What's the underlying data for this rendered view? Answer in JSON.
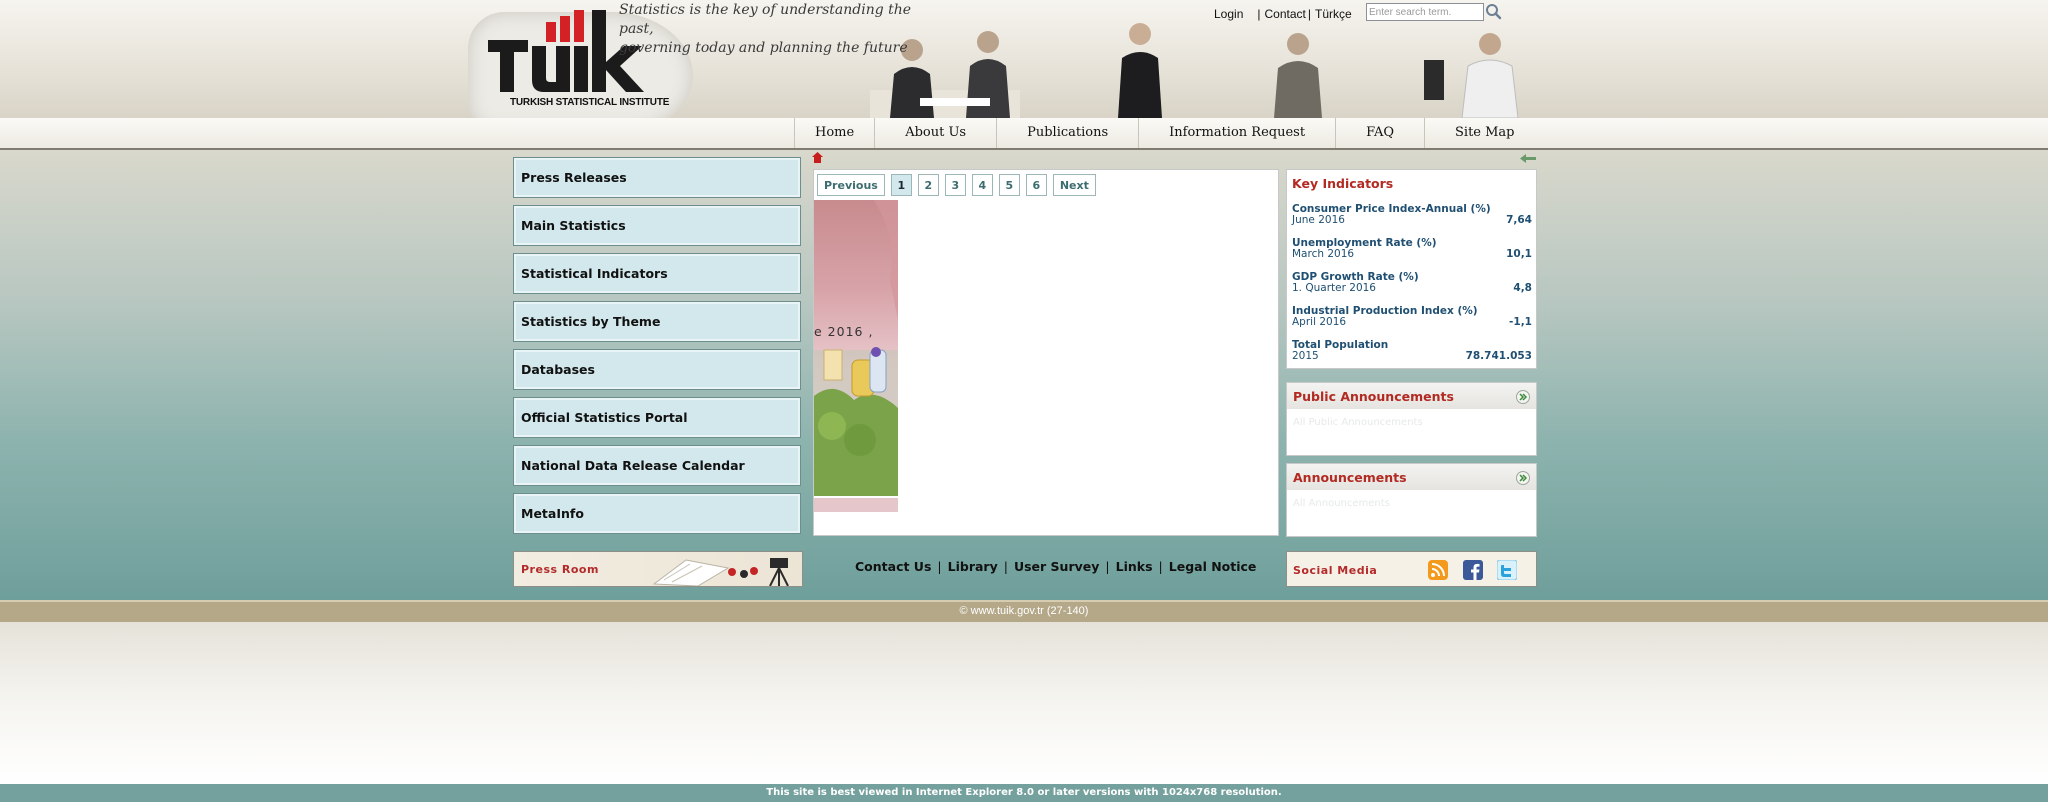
{
  "header": {
    "slogan_line1": "Statistics is the key of understanding the past,",
    "slogan_line2": "governing today and planning the future",
    "logo_caption": "TURKISH STATISTICAL INSTITUTE",
    "logo_text": "tüik"
  },
  "top_links": {
    "login": "Login",
    "sep1": "|",
    "contact": "Contact",
    "sep2": "|",
    "language": "Türkçe",
    "search_placeholder": "Enter search term."
  },
  "nav": [
    "Home",
    "About Us",
    "Publications",
    "Information Request",
    "FAQ",
    "Site Map"
  ],
  "left_menu": [
    "Press Releases",
    "Main Statistics",
    "Statistical Indicators",
    "Statistics by Theme",
    "Databases",
    "Official Statistics Portal",
    "National Data Release Calendar",
    "MetaInfo"
  ],
  "press_room": "Press Room",
  "pager": {
    "previous": "Previous",
    "pages": [
      "1",
      "2",
      "3",
      "4",
      "5",
      "6"
    ],
    "active": "1",
    "next": "Next"
  },
  "slide": {
    "caption": "e 2016 ,"
  },
  "key_indicators": {
    "title": "Key Indicators",
    "items": [
      {
        "label": "Consumer Price Index-Annual (%)",
        "period": "June 2016",
        "value": "7,64"
      },
      {
        "label": "Unemployment Rate (%)",
        "period": "March 2016",
        "value": "10,1"
      },
      {
        "label": "GDP Growth Rate (%)",
        "period": "1. Quarter 2016",
        "value": "4,8"
      },
      {
        "label": "Industrial Production Index (%)",
        "period": "April 2016",
        "value": "-1,1"
      },
      {
        "label": "Total Population",
        "period": "2015",
        "value": "78.741.053"
      }
    ]
  },
  "public_announcements": {
    "title": "Public Announcements",
    "faint": "All Public Announcements"
  },
  "announcements": {
    "title": "Announcements",
    "faint": "All Announcements"
  },
  "footer_links": [
    "Contact Us",
    "Library",
    "User Survey",
    "Links",
    "Legal Notice"
  ],
  "social": {
    "label": "Social Media",
    "icons": [
      "rss-icon",
      "facebook-icon",
      "twitter-icon"
    ]
  },
  "copyright": "© www.tuik.gov.tr (27-140)",
  "browser_note": "This site is best viewed in Internet Explorer 8.0 or later versions with 1024x768 resolution.",
  "colors": {
    "accent_red": "#b22a22",
    "menu_bg": "#d2e8ec",
    "teal_bottom": "#74a19e",
    "footer_tan": "#b4a889",
    "indicator_blue": "#1f4f72"
  }
}
